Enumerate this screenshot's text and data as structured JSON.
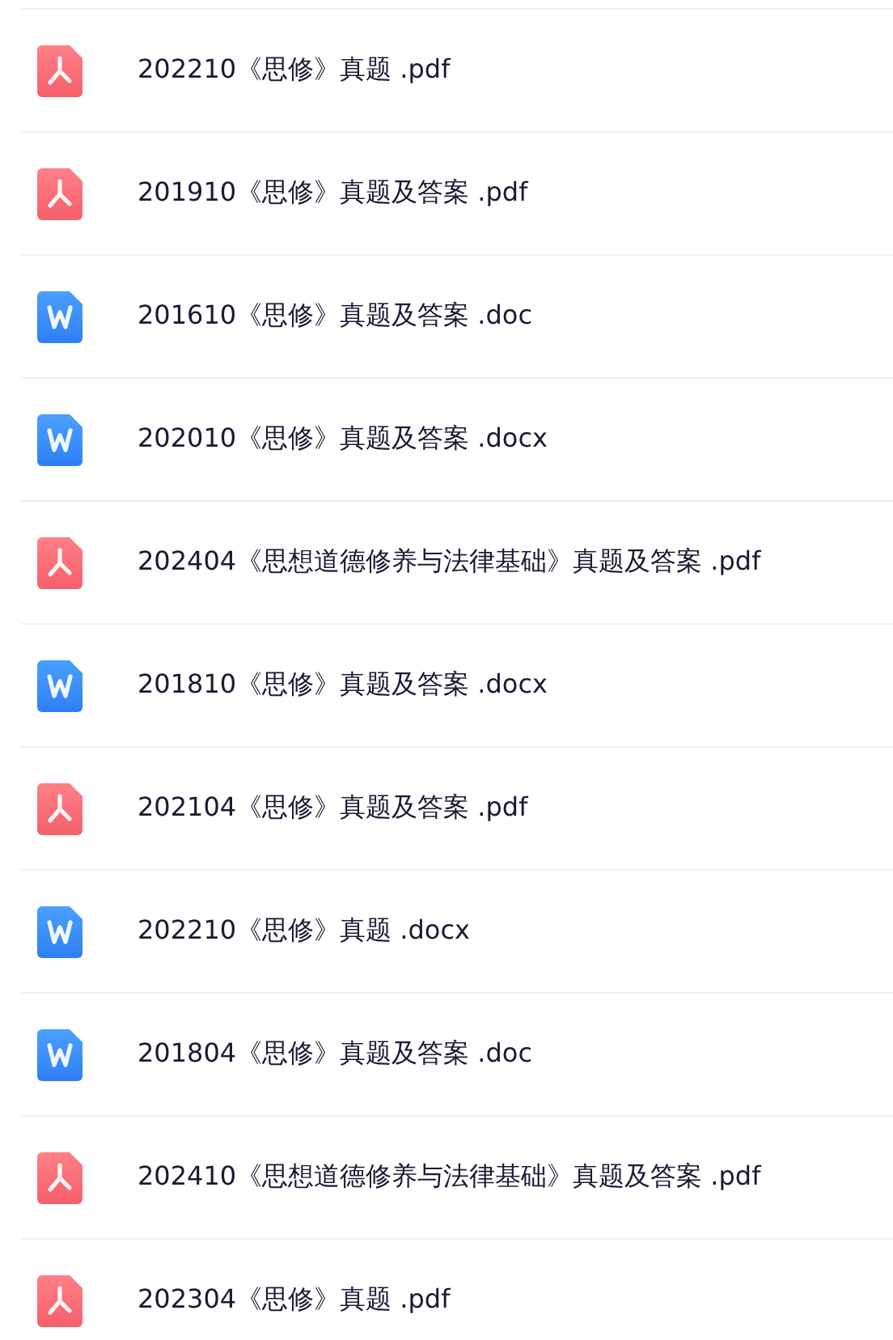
{
  "files": [
    {
      "kind": "pdf",
      "name": "202210《思修》真题 .pdf"
    },
    {
      "kind": "pdf",
      "name": "201910《思修》真题及答案 .pdf"
    },
    {
      "kind": "word",
      "name": "201610《思修》真题及答案 .doc"
    },
    {
      "kind": "word",
      "name": "202010《思修》真题及答案 .docx"
    },
    {
      "kind": "pdf",
      "name": "202404《思想道德修养与法律基础》真题及答案 .pdf"
    },
    {
      "kind": "word",
      "name": "201810《思修》真题及答案 .docx"
    },
    {
      "kind": "pdf",
      "name": "202104《思修》真题及答案 .pdf"
    },
    {
      "kind": "word",
      "name": "202210《思修》真题 .docx"
    },
    {
      "kind": "word",
      "name": "201804《思修》真题及答案 .doc"
    },
    {
      "kind": "pdf",
      "name": "202410《思想道德修养与法律基础》真题及答案 .pdf"
    },
    {
      "kind": "pdf",
      "name": "202304《思修》真题 .pdf"
    }
  ]
}
